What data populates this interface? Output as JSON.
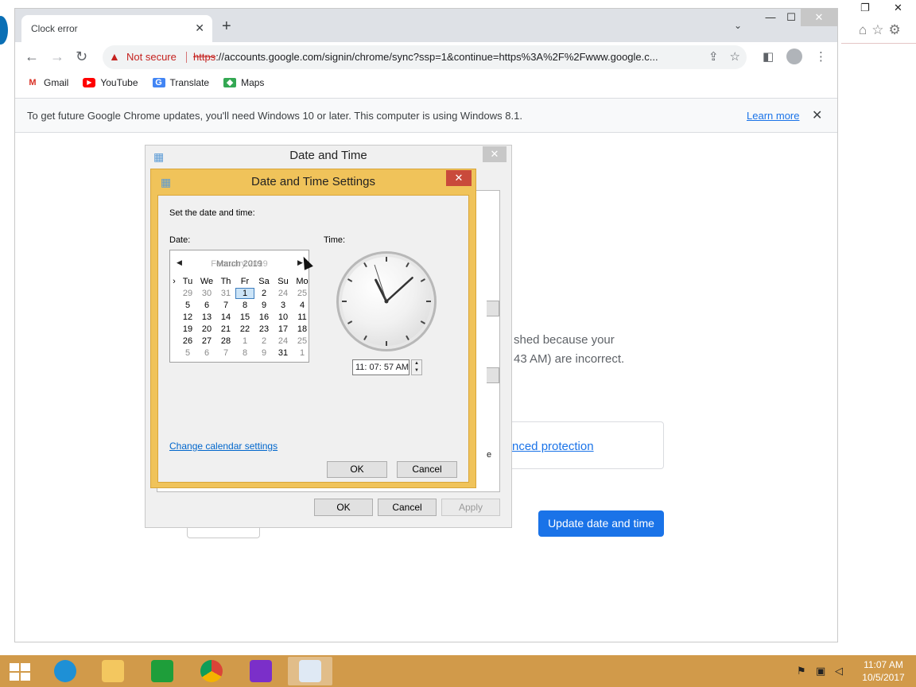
{
  "chrome": {
    "tab_title": "Clock error",
    "tab_close": "✕",
    "new_tab": "+",
    "tab_search": "⌄",
    "not_secure": "Not secure",
    "url_scheme": "https",
    "url_rest": "://accounts.google.com/signin/chrome/sync?ssp=1&continue=https%3A%2F%2Fwww.google.c...",
    "bookmarks": [
      {
        "label": "Gmail",
        "icon": "gmail-icon"
      },
      {
        "label": "YouTube",
        "icon": "youtube-icon"
      },
      {
        "label": "Translate",
        "icon": "translate-icon"
      },
      {
        "label": "Maps",
        "icon": "maps-icon"
      }
    ],
    "infobar_text": "To get future Google Chrome updates, you'll need Windows 10 or later. This computer is using Windows 8.1.",
    "learn_more": "Learn more"
  },
  "page": {
    "error_line1": "shed because your",
    "error_line2": "43 AM) are incorrect.",
    "advanced_link": "nced protection",
    "update_button": "Update date and time"
  },
  "date_time_dialog": {
    "title": "Date and Time",
    "ok": "OK",
    "cancel": "Cancel",
    "apply": "Apply",
    "partial_e": "e"
  },
  "settings_dialog": {
    "title": "Date and Time Settings",
    "instruction": "Set the date and time:",
    "date_label": "Date:",
    "time_label": "Time:",
    "month_label": "March 2019",
    "month_label_overlay": "February 2019",
    "day_headers": [
      "›",
      "Tu",
      "We",
      "Th",
      "Fr",
      "Sa",
      "Su",
      "Mo"
    ],
    "weeks": [
      [
        "29",
        "30",
        "31",
        "1",
        "2",
        "24",
        "25"
      ],
      [
        "5",
        "6",
        "7",
        "8",
        "9",
        "3",
        "4"
      ],
      [
        "12",
        "13",
        "14",
        "15",
        "16",
        "10",
        "11"
      ],
      [
        "19",
        "20",
        "21",
        "22",
        "23",
        "17",
        "18"
      ],
      [
        "26",
        "27",
        "28",
        "1",
        "2",
        "24",
        "25"
      ],
      [
        "5",
        "6",
        "7",
        "8",
        "9",
        "31",
        "1"
      ]
    ],
    "time_value": "11: 07: 57 AM",
    "change_calendar": "Change calendar settings",
    "ok": "OK",
    "cancel": "Cancel"
  },
  "taskbar": {
    "time": "11:07 AM",
    "date": "10/5/2017"
  },
  "colors": {
    "chrome_blue": "#1a73e8",
    "not_secure_red": "#c5221f",
    "dialog_gold": "#f0c35a",
    "close_red": "#c94a3b",
    "taskbar": "#d19a4a"
  }
}
